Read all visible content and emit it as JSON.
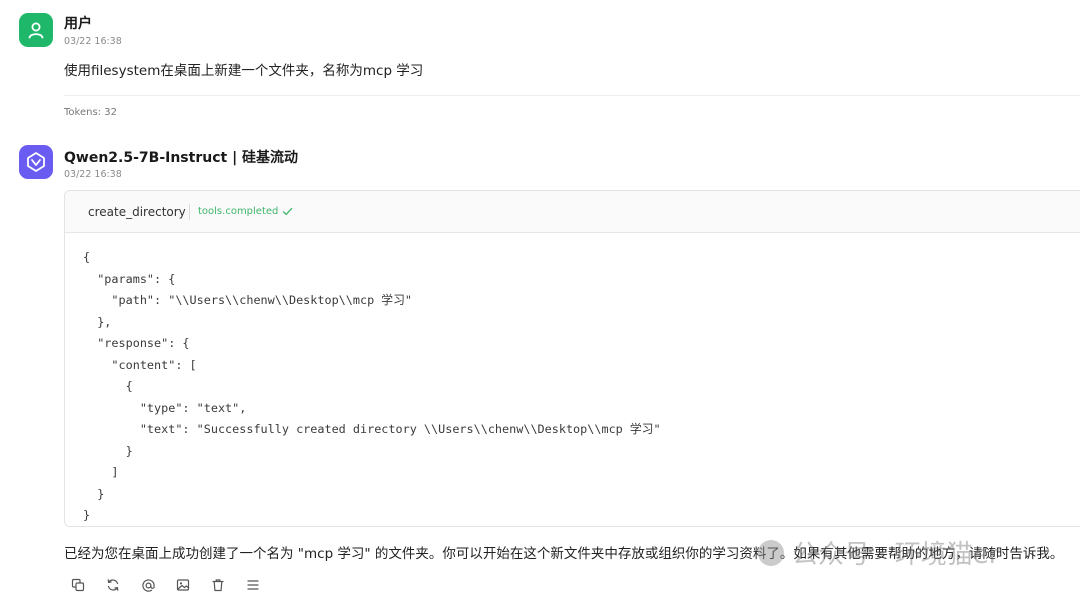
{
  "user_message": {
    "author": "用户",
    "time": "03/22 16:38",
    "text": "使用filesystem在桌面上新建一个文件夹，名称为mcp 学习",
    "tokens": "Tokens: 32",
    "avatar_icon": "user-icon",
    "avatar_color": "#1fb86b"
  },
  "bot_message": {
    "author": "Qwen2.5-7B-Instruct | 硅基流动",
    "time": "03/22 16:38",
    "avatar_icon": "qwen-logo-icon",
    "avatar_color": "#6a5cf0",
    "tool_call": {
      "name": "create_directory",
      "status": "tools.completed",
      "status_icon": "check-icon",
      "status_color": "#3fb56a",
      "code": "{\n  \"params\": {\n    \"path\": \"\\\\Users\\\\chenw\\\\Desktop\\\\mcp 学习\"\n  },\n  \"response\": {\n    \"content\": [\n      {\n        \"type\": \"text\",\n        \"text\": \"Successfully created directory \\\\Users\\\\chenw\\\\Desktop\\\\mcp 学习\"\n      }\n    ]\n  }\n}"
    },
    "reply": "已经为您在桌面上成功创建了一个名为 \"mcp 学习\" 的文件夹。你可以开始在这个新文件夹中存放或组织你的学习资料了。如果有其他需要帮助的地方，请随时告诉我。"
  },
  "watermark": "公众号 · 环境猫er",
  "toolbar": [
    {
      "name": "copy-icon"
    },
    {
      "name": "regenerate-icon"
    },
    {
      "name": "mention-icon"
    },
    {
      "name": "image-icon"
    },
    {
      "name": "delete-icon"
    },
    {
      "name": "menu-icon"
    }
  ]
}
